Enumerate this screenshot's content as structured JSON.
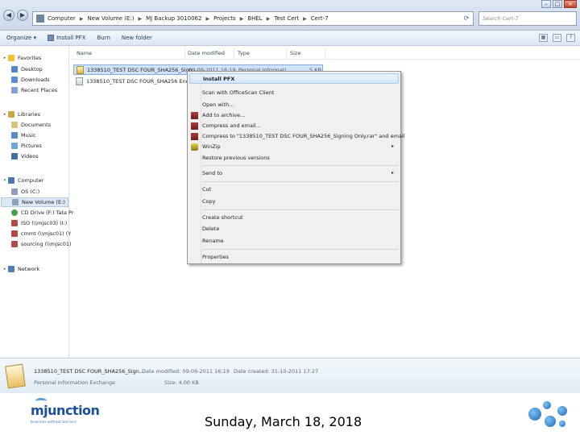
{
  "window": {
    "nav_back": "◀",
    "nav_forward": "▶",
    "breadcrumb": [
      "Computer",
      "New Volume (E:)",
      "MJ Backup 3010062",
      "Projects",
      "BHEL",
      "Test Cert",
      "Cert-7"
    ],
    "search_placeholder": "Search Cert-7",
    "controls": {
      "minimize": "–",
      "maximize": "□",
      "close": "×"
    }
  },
  "toolbar": {
    "organize": "Organize ▾",
    "install_pfx": "Install PFX",
    "burn": "Burn",
    "new_folder": "New folder"
  },
  "navpane": {
    "favorites": {
      "label": "Favorites",
      "items": [
        "Desktop",
        "Downloads",
        "Recent Places"
      ]
    },
    "libraries": {
      "label": "Libraries",
      "items": [
        "Documents",
        "Music",
        "Pictures",
        "Videos"
      ]
    },
    "computer": {
      "label": "Computer",
      "items": [
        "OS (C:)",
        "New Volume (E:)",
        "CD Drive (F:) Tata Pr",
        "ISO (\\\\mjsc03) (I:)",
        "cmmt (\\\\mjsc01) (Y",
        "sourcing (\\\\mjsc01)"
      ]
    },
    "network": {
      "label": "Network"
    }
  },
  "columns": {
    "name": "Name",
    "date_modified": "Date modified",
    "type": "Type",
    "size": "Size"
  },
  "files": [
    {
      "name": "1338510_TEST DSC FOUR_SHA256_Sign...",
      "date": "09-09-2011 16:19",
      "type": "Personal Informati...",
      "size": "5 KB"
    },
    {
      "name": "1338510_TEST DSC FOUR_SHA256 Encryp..."
    }
  ],
  "context_menu": {
    "install_pfx": "Install PFX",
    "scan": "Scan with OfficeScan Client",
    "open_with": "Open with...",
    "add_archive": "Add to archive...",
    "compress_email": "Compress and email...",
    "compress_to": "Compress to \"1338510_TEST DSC FOUR_SHA256_Signing Only.rar\" and email",
    "winzip": "WinZip",
    "restore": "Restore previous versions",
    "send_to": "Send to",
    "cut": "Cut",
    "copy": "Copy",
    "create_shortcut": "Create shortcut",
    "delete": "Delete",
    "rename": "Rename",
    "properties": "Properties",
    "arrow": "▸"
  },
  "details": {
    "name": "1338510_TEST DSC FOUR_SHA256_Sign...",
    "date_modified": "Date modified: 09-09-2011 16:19",
    "date_created": "Date created: 31-10-2011 17:27",
    "type": "Personal Information Exchange",
    "size": "Size: 4.00 KB"
  },
  "footer": {
    "logo": "mjunction",
    "tagline": "business without barriers",
    "date": "Sunday, March 18, 2018"
  },
  "colors": {
    "selection": "#cfe2f8",
    "menu_bg": "#f0f0f0",
    "logo_blue": "#1a4f9b"
  }
}
